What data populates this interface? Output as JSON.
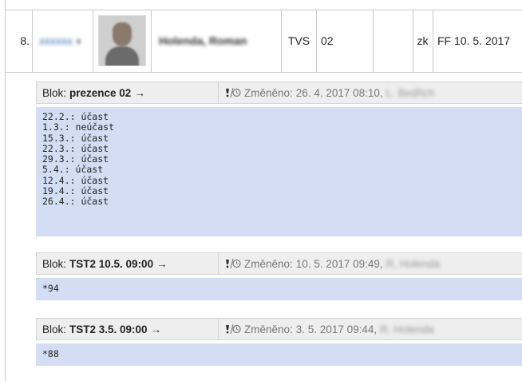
{
  "row": {
    "number": "8.",
    "id_blurred": "xxxxxx",
    "name_blurred": "Holenda, Roman",
    "code": "TVS",
    "group": "02",
    "empty": "",
    "type": "zk",
    "date": "FF 10. 5. 2017"
  },
  "blocks": [
    {
      "prefix": "Blok:",
      "title": "prezence 02",
      "arrow": "→",
      "changed_label": "Změněno:",
      "changed_date": "26. 4. 2017 08:10,",
      "changed_by": "L. Bedřich",
      "body": "22.2.: účast\n1.3.: neúčast\n15.3.: účast\n22.3.: účast\n29.3.: účast\n5.4.: účast\n12.4.: účast\n19.4.: účast\n26.4.: účast"
    },
    {
      "prefix": "Blok:",
      "title": "TST2 10.5. 09:00",
      "arrow": "→",
      "changed_label": "Změněno:",
      "changed_date": "10. 5. 2017 09:49,",
      "changed_by": "R. Holenda",
      "body": "*94"
    },
    {
      "prefix": "Blok:",
      "title": "TST2 3.5. 09:00",
      "arrow": "→",
      "changed_label": "Změněno:",
      "changed_date": "3. 5. 2017 09:44,",
      "changed_by": "R. Holenda",
      "body": "*88"
    }
  ],
  "icons": {
    "edit": "notes-clock-icon"
  },
  "colors": {
    "body_bg": "#d3ddf3",
    "header_bg": "#eeeeee",
    "link_blue": "#3a6fb0"
  }
}
